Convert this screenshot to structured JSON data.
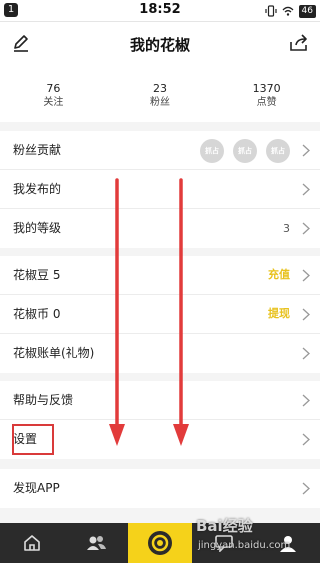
{
  "status_bar": {
    "notification_count": "1",
    "time": "18:52",
    "battery": "46",
    "icons": [
      "vibrate-icon",
      "wifi-icon"
    ]
  },
  "header": {
    "title": "我的花椒",
    "left_icon": "edit-icon",
    "right_icon": "share-icon"
  },
  "stats": [
    {
      "value": "76",
      "label": "关注"
    },
    {
      "value": "23",
      "label": "粉丝"
    },
    {
      "value": "1370",
      "label": "点赞"
    }
  ],
  "menu": {
    "fans_contribution": {
      "label": "粉丝贡献",
      "avatar_text": [
        "抓占",
        "抓占",
        "抓占"
      ]
    },
    "my_posts": {
      "label": "我发布的"
    },
    "my_level": {
      "label": "我的等级",
      "value": "3"
    },
    "beans": {
      "label": "花椒豆 5",
      "action": "充值"
    },
    "coins": {
      "label": "花椒币 0",
      "action": "提现"
    },
    "bill": {
      "label": "花椒账单(礼物)"
    },
    "help": {
      "label": "帮助与反馈"
    },
    "settings": {
      "label": "设置"
    },
    "discover": {
      "label": "发现APP"
    }
  },
  "tabbar": {
    "tabs": [
      "home-icon",
      "friends-icon",
      "live-camera-icon",
      "message-icon",
      "profile-icon"
    ],
    "active": "profile-icon",
    "accent_color": "#f5d21a"
  },
  "watermark": {
    "brand": "Bai经验",
    "url": "jingyan.baidu.com"
  },
  "colors": {
    "accent_yellow": "#e8c21e",
    "annotation_red": "#d93a3a"
  }
}
